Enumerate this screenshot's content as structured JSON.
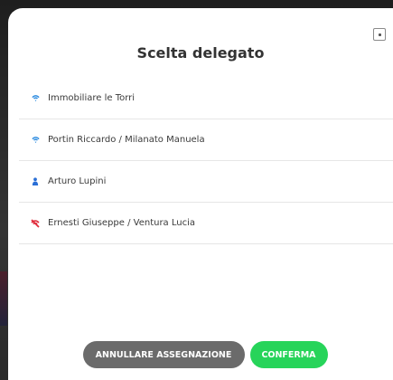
{
  "dialog": {
    "title": "Scelta delegato",
    "close_label": "close"
  },
  "delegates": [
    {
      "label": "Immobiliare le Torri",
      "icon": "wifi-icon",
      "color": "#2a8ae0"
    },
    {
      "label": "Portin Riccardo / Milanato Manuela",
      "icon": "wifi-icon",
      "color": "#2a8ae0"
    },
    {
      "label": "Arturo Lupini",
      "icon": "person-icon",
      "color": "#2a6fd6"
    },
    {
      "label": "Ernesti Giuseppe / Ventura Lucia",
      "icon": "broken-signal-icon",
      "color": "#e02d3c"
    }
  ],
  "actions": {
    "cancel_label": "ANNULLARE ASSEGNAZIONE",
    "confirm_label": "CONFERMA"
  },
  "colors": {
    "confirm": "#27d45a",
    "cancel": "#6b6b6b"
  }
}
